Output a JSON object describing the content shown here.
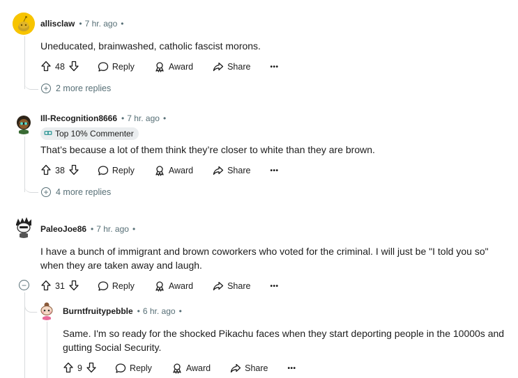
{
  "comments": [
    {
      "username": "allisclaw",
      "time": "7 hr. ago",
      "body": "Uneducated, brainwashed, catholic fascist morons.",
      "votes": "48",
      "more_replies": "2 more replies"
    },
    {
      "username": "Ill-Recognition8666",
      "time": "7 hr. ago",
      "flair": "Top 10% Commenter",
      "body": "That’s because a lot of them think they’re closer to white than they are brown.",
      "votes": "38",
      "more_replies": "4 more replies"
    },
    {
      "username": "PaleoJoe86",
      "time": "7 hr. ago",
      "body_line1": "I have a bunch of immigrant and brown coworkers who voted for the criminal. I will just be \"I told you so\"",
      "body_line2": "when they are taken away and laugh.",
      "votes": "31"
    },
    {
      "username": "Burntfruitypebble",
      "time": "6 hr. ago",
      "body_line1": "Same. I'm so ready for the shocked Pikachu faces when they start deporting people in the 10000s and",
      "body_line2": "gutting Social Security.",
      "votes": "9"
    }
  ],
  "actions": {
    "reply": "Reply",
    "award": "Award",
    "share": "Share",
    "more": "•••"
  },
  "separator": "•",
  "icons": [
    "upvote-icon",
    "downvote-icon",
    "reply-icon",
    "award-icon",
    "share-icon",
    "more-icon",
    "expand-icon",
    "collapse-icon",
    "flair-icon"
  ],
  "colors": {
    "text": "#1c1c1c",
    "muted": "#576f76",
    "line": "#d7dadc",
    "flair_bg": "#eaedef",
    "snoo_yellow": "#f7c400"
  }
}
